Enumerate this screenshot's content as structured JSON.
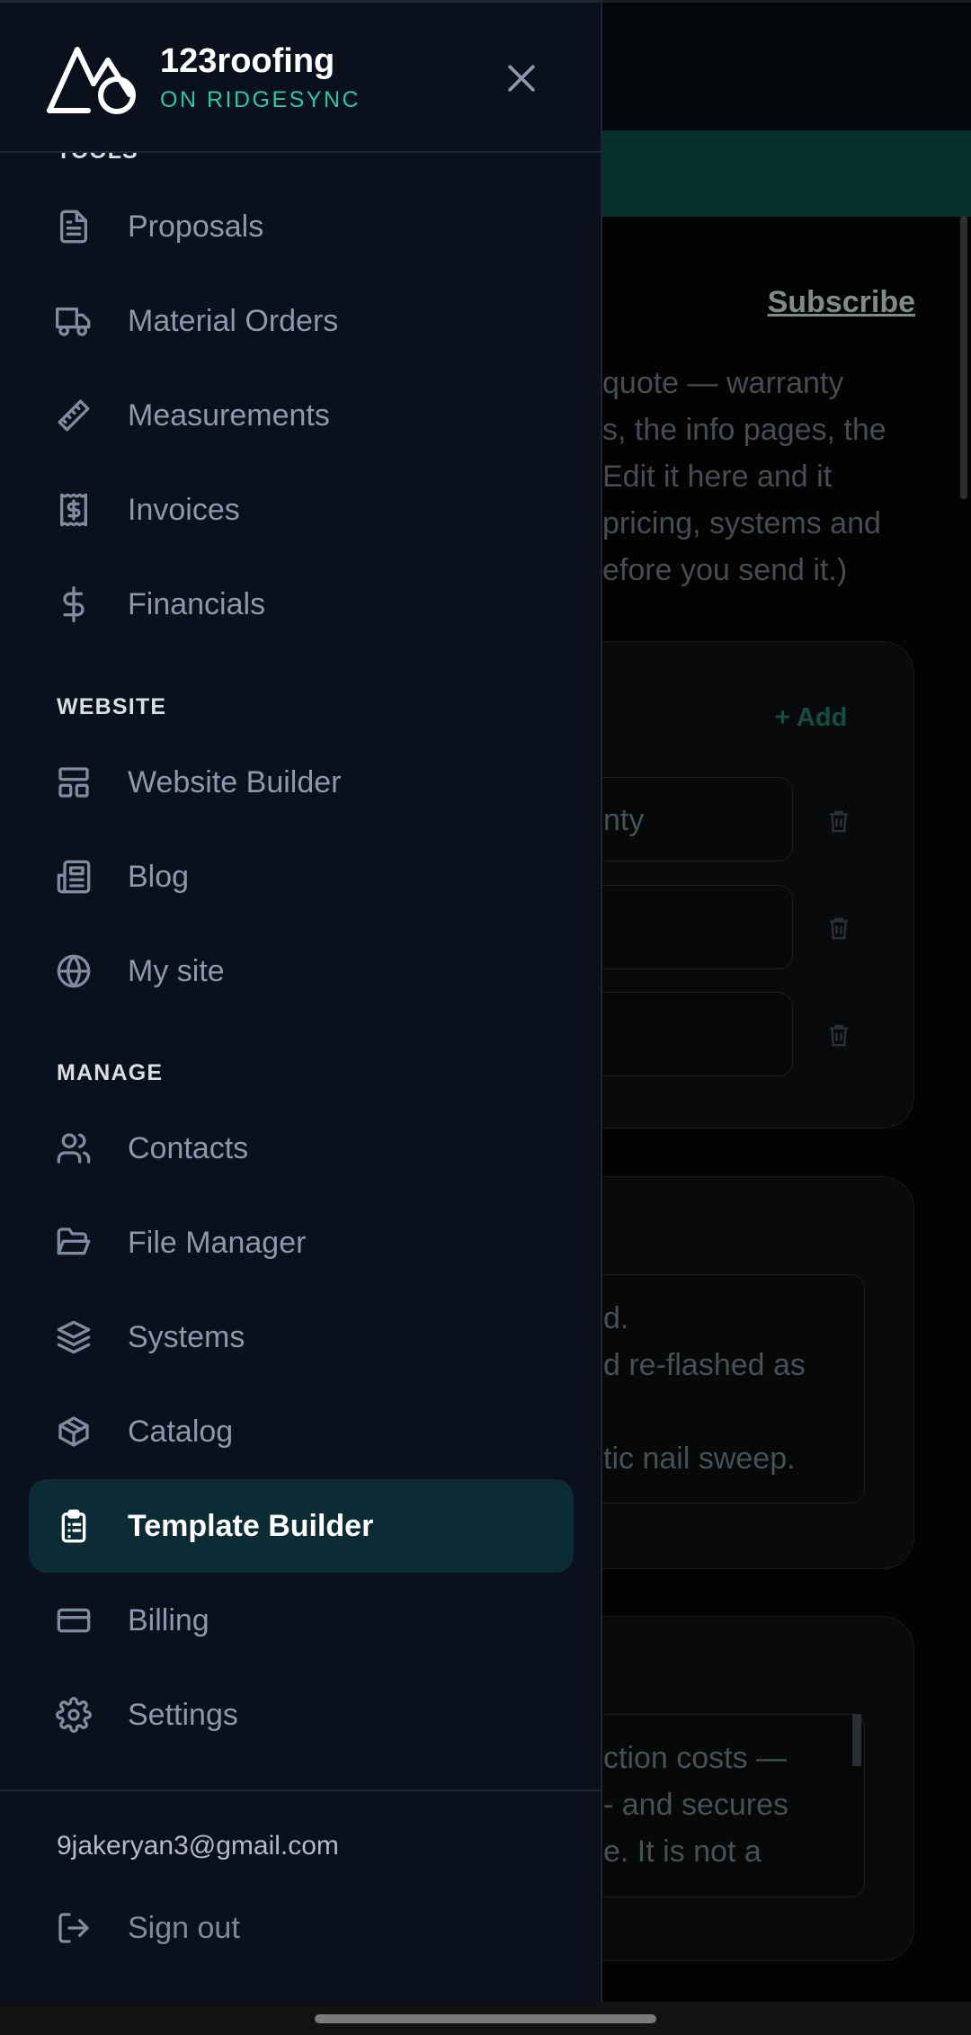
{
  "background": {
    "subscribe_label": "Subscribe",
    "description_lines": [
      "quote — warranty",
      "s, the info pages, the",
      "Edit it here and it",
      "pricing, systems and",
      "efore you send it.)"
    ],
    "add_label": "Add",
    "inputs": [
      "nty",
      "",
      ""
    ],
    "textarea1_lines": [
      "d.",
      "d re-flashed as",
      "",
      "tic nail sweep."
    ],
    "textarea2_lines": [
      "ction costs —",
      "- and secures",
      "e. It is not a"
    ]
  },
  "drawer": {
    "brand": {
      "name": "123roofing",
      "subtitle": "ON RIDGESYNC",
      "logo_icon": "mountain-logo-icon",
      "accent_color": "#2cc7a4"
    },
    "close_icon": "close-icon",
    "tools_section_label": "TOOLS",
    "tools": [
      {
        "label": "Proposals",
        "icon": "document-icon"
      },
      {
        "label": "Material Orders",
        "icon": "truck-icon"
      },
      {
        "label": "Measurements",
        "icon": "ruler-icon"
      },
      {
        "label": "Invoices",
        "icon": "receipt-icon"
      },
      {
        "label": "Financials",
        "icon": "dollar-icon"
      }
    ],
    "website_section_label": "WEBSITE",
    "website": [
      {
        "label": "Website Builder",
        "icon": "layout-icon"
      },
      {
        "label": "Blog",
        "icon": "newspaper-icon"
      },
      {
        "label": "My site",
        "icon": "globe-icon"
      }
    ],
    "manage_section_label": "MANAGE",
    "manage": [
      {
        "label": "Contacts",
        "icon": "users-icon"
      },
      {
        "label": "File Manager",
        "icon": "folder-icon"
      },
      {
        "label": "Systems",
        "icon": "layers-icon"
      },
      {
        "label": "Catalog",
        "icon": "package-icon"
      },
      {
        "label": "Template Builder",
        "icon": "clipboard-icon",
        "active": true
      },
      {
        "label": "Billing",
        "icon": "credit-card-icon"
      },
      {
        "label": "Settings",
        "icon": "gear-icon"
      }
    ],
    "footer": {
      "email": "9jakeryan3@gmail.com",
      "signout_label": "Sign out",
      "signout_icon": "sign-out-icon"
    },
    "active_color": "#0b2c34"
  }
}
